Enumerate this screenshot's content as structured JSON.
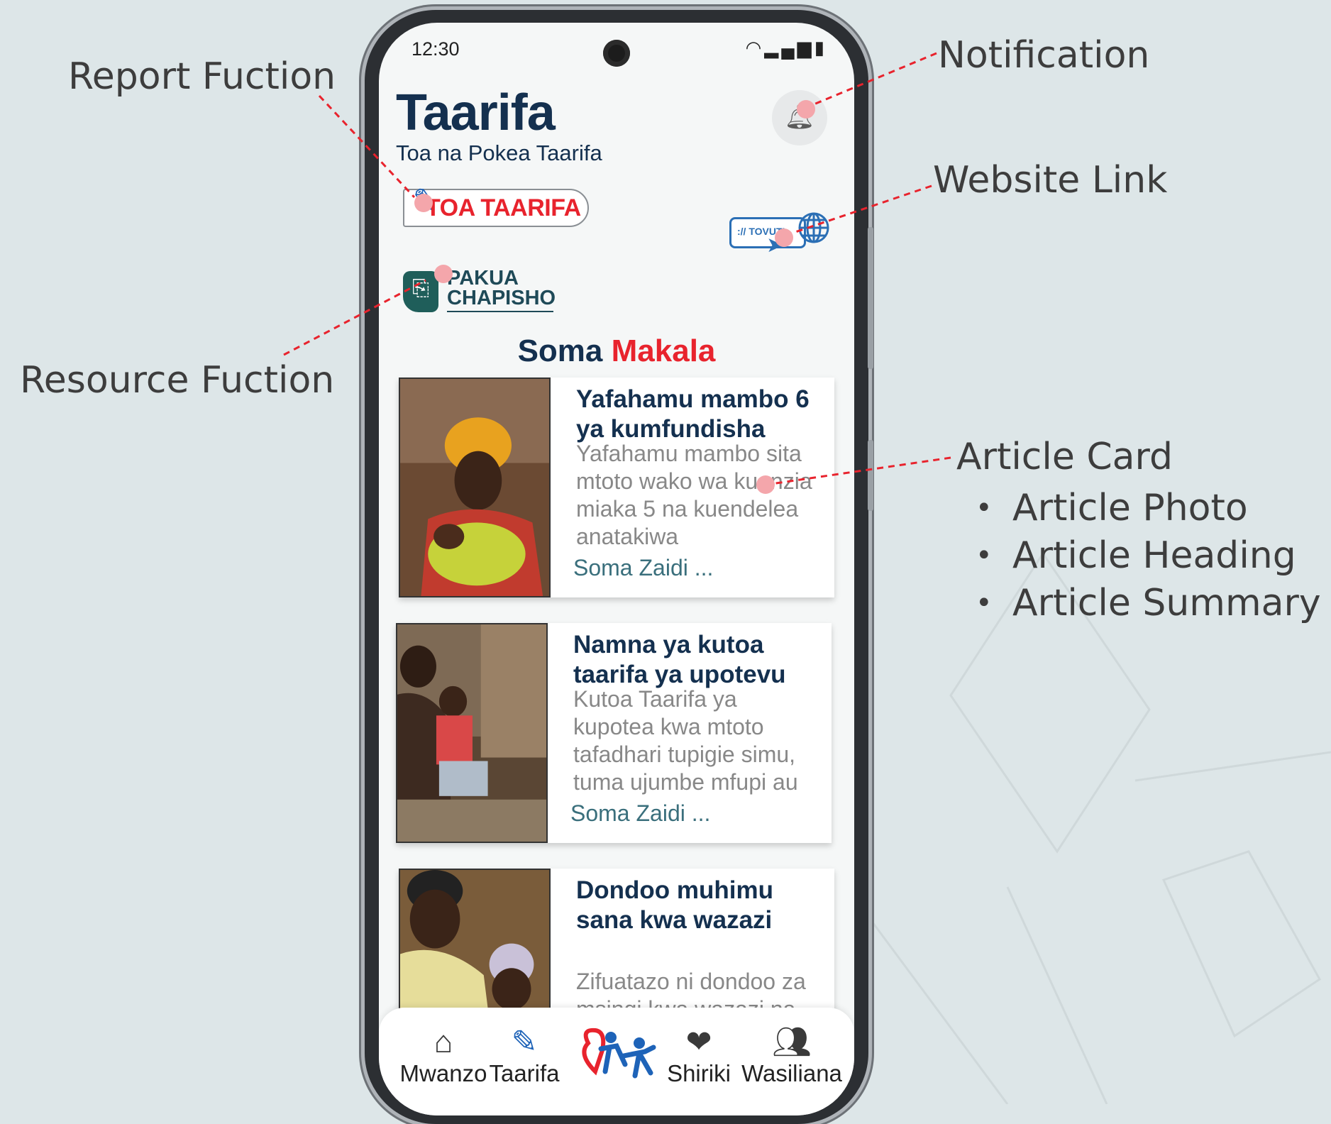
{
  "callouts": {
    "report": "Report Fuction",
    "resource": "Resource Fuction",
    "notification": "Notification",
    "website": "Website Link",
    "article_card": "Article Card",
    "article_parts": [
      "Article Photo",
      "Article Heading",
      "Article Summary"
    ]
  },
  "status_bar": {
    "time": "12:30",
    "icons": [
      "wifi-icon",
      "signal-icon",
      "battery-icon"
    ]
  },
  "header": {
    "title": "Taarifa",
    "subtitle": "Toa na Pokea Taarifa"
  },
  "actions": {
    "report_label": "TOA TAARIFA",
    "website_label": ":// TOVUTI",
    "resource_line1": "PAKUA",
    "resource_line2": "CHAPISHO"
  },
  "section": {
    "title_part1": "Soma",
    "title_part2": "Makala"
  },
  "articles": [
    {
      "heading": "Yafahamu mambo 6 ya kumfundisha",
      "summary": "Yafahamu mambo sita mtoto wako wa kuanzia miaka 5 na kuendelea anatakiwa",
      "more": "Soma Zaidi ..."
    },
    {
      "heading": "Namna ya kutoa taarifa ya upotevu",
      "summary": "Kutoa Taarifa ya kupotea kwa mtoto tafadhari tupigie simu, tuma ujumbe mfupi au",
      "more": "Soma Zaidi ..."
    },
    {
      "heading": "Dondoo muhimu sana kwa wazazi",
      "summary": "Zifuatazo ni dondoo za msingi kwa wazazi na",
      "more": ""
    }
  ],
  "bottom_nav": [
    {
      "label": "Mwanzo",
      "icon": "home-icon"
    },
    {
      "label": "Taarifa",
      "icon": "report-edit-icon"
    },
    {
      "label": "Shiriki",
      "icon": "heart-share-icon"
    },
    {
      "label": "Wasiliana",
      "icon": "group-icon"
    }
  ],
  "colors": {
    "navy": "#14304f",
    "red": "#e8232d",
    "accent_blue": "#2b6fb5",
    "teal": "#1f5e5a"
  }
}
